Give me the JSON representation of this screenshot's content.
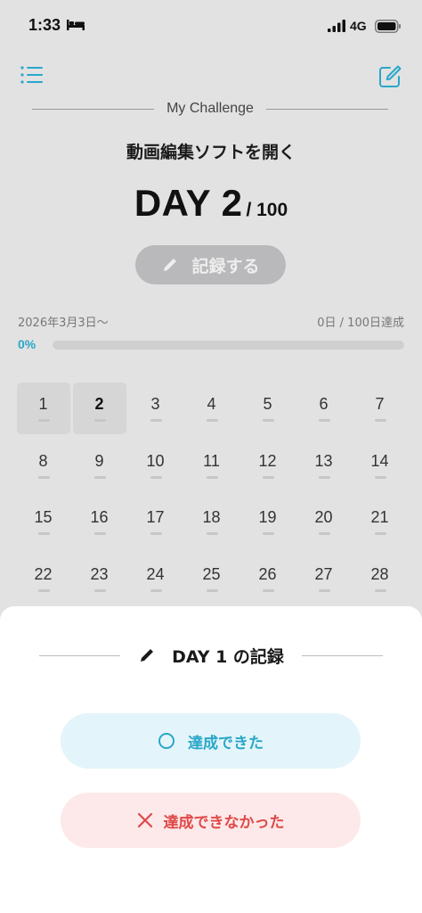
{
  "status_bar": {
    "time": "1:33",
    "network": "4G"
  },
  "header": {
    "title": "My Challenge",
    "challenge_name": "動画編集ソフトを開く",
    "day_label": "DAY 2",
    "day_total": "/ 100",
    "record_button_label": "記録する"
  },
  "progress": {
    "start_date": "2026年3月3日〜",
    "achieved_text": "0日 / 100日達成",
    "percent_text": "0%",
    "fraction": 0
  },
  "calendar": {
    "days": [
      {
        "n": "1",
        "marked": true,
        "today": false
      },
      {
        "n": "2",
        "marked": true,
        "today": true
      },
      {
        "n": "3"
      },
      {
        "n": "4"
      },
      {
        "n": "5"
      },
      {
        "n": "6"
      },
      {
        "n": "7"
      },
      {
        "n": "8"
      },
      {
        "n": "9"
      },
      {
        "n": "10"
      },
      {
        "n": "11"
      },
      {
        "n": "12"
      },
      {
        "n": "13"
      },
      {
        "n": "14"
      },
      {
        "n": "15"
      },
      {
        "n": "16"
      },
      {
        "n": "17"
      },
      {
        "n": "18"
      },
      {
        "n": "19"
      },
      {
        "n": "20"
      },
      {
        "n": "21"
      },
      {
        "n": "22"
      },
      {
        "n": "23"
      },
      {
        "n": "24"
      },
      {
        "n": "25"
      },
      {
        "n": "26"
      },
      {
        "n": "27"
      },
      {
        "n": "28"
      }
    ]
  },
  "sheet": {
    "title": "DAY 1 の記録",
    "achieved_label": "達成できた",
    "not_achieved_label": "達成できなかった"
  },
  "colors": {
    "accent": "#2aa7c9",
    "danger": "#e04848",
    "achieved_bg": "#e3f5fa",
    "not_achieved_bg": "#fde9e9"
  }
}
